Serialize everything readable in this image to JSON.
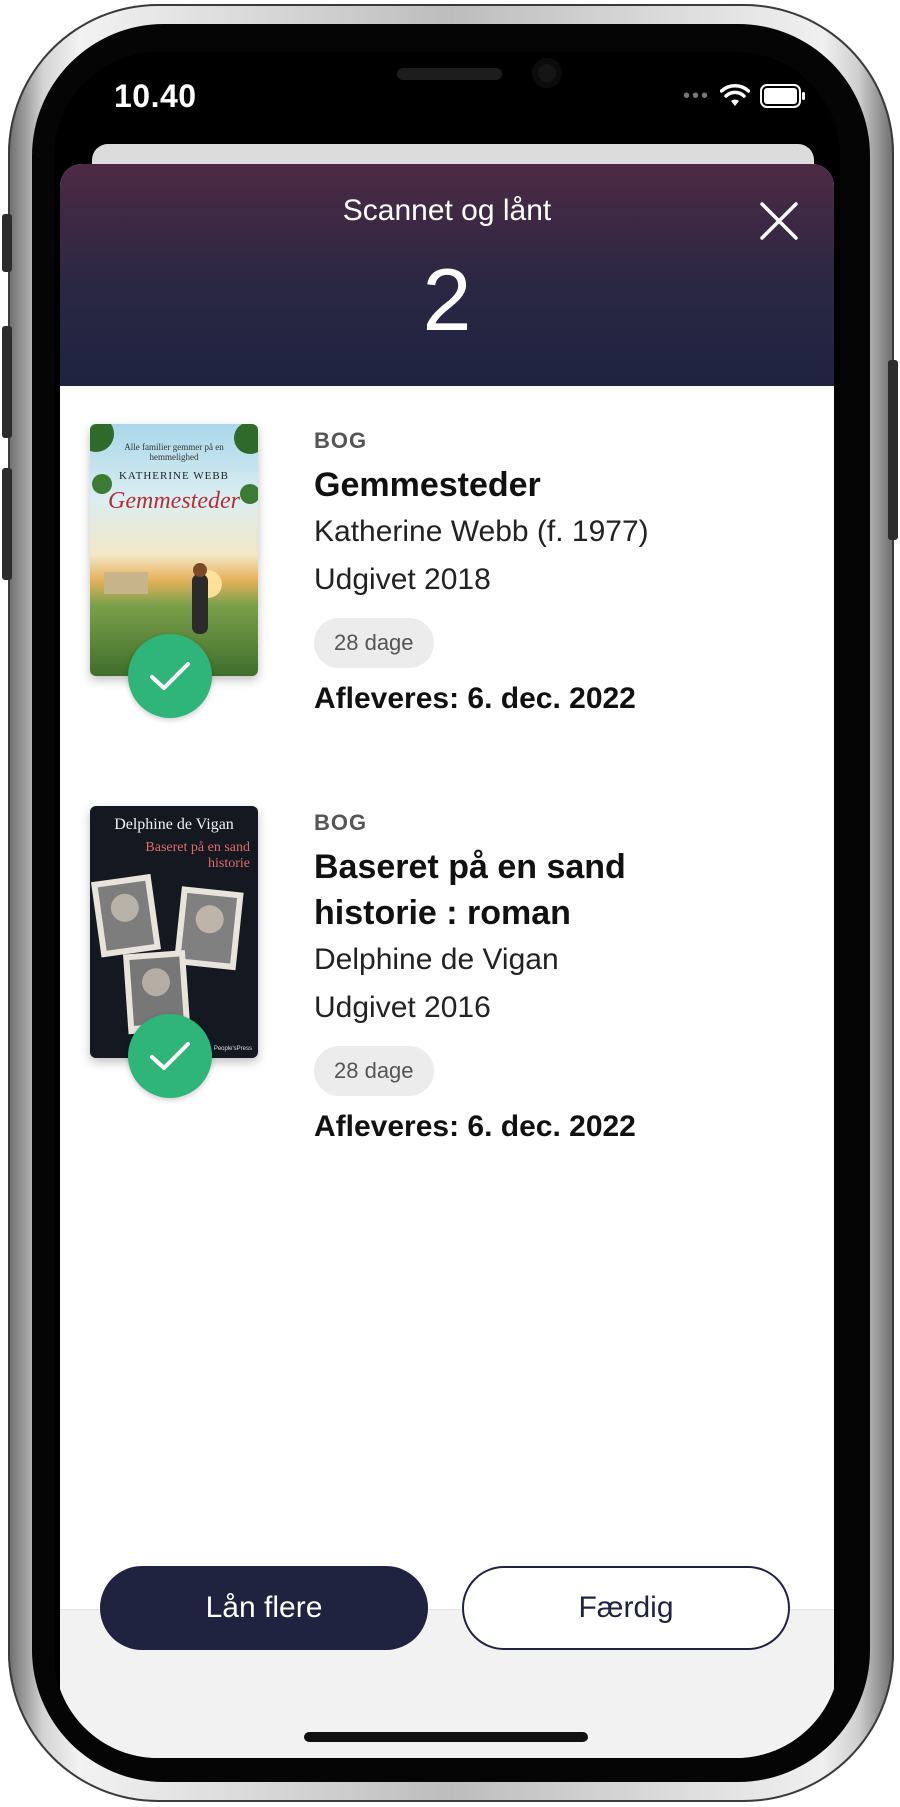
{
  "status_bar": {
    "time": "10.40",
    "dots": "•••",
    "wifi_icon": "wifi-icon",
    "battery_icon": "battery-icon"
  },
  "header": {
    "title": "Scannet og lånt",
    "count": "2",
    "close_icon": "close-icon"
  },
  "loans": [
    {
      "type": "BOG",
      "title": "Gemmesteder",
      "author": "Katherine Webb (f. 1977)",
      "published": "Udgivet 2018",
      "duration": "28 dage",
      "due": "Afleveres: 6. dec. 2022",
      "cover": {
        "tagline": "Alle familier gemmer på en hemmelighed",
        "author": "KATHERINE WEBB",
        "title": "Gemmesteder"
      }
    },
    {
      "type": "BOG",
      "title": "Baseret på en sand historie : roman",
      "author": "Delphine de Vigan",
      "published": "Udgivet 2016",
      "duration": "28 dage",
      "due": "Afleveres: 6. dec. 2022",
      "cover": {
        "author": "Delphine de Vigan",
        "title": "Baseret på en sand historie",
        "publisher": "People'sPress"
      }
    }
  ],
  "footer": {
    "primary_label": "Lån flere",
    "secondary_label": "Færdig"
  },
  "colors": {
    "header_gradient_top": "#4d2a44",
    "header_gradient_bottom": "#1e2340",
    "check": "#2fb57a",
    "primary_button": "#1f2340"
  }
}
